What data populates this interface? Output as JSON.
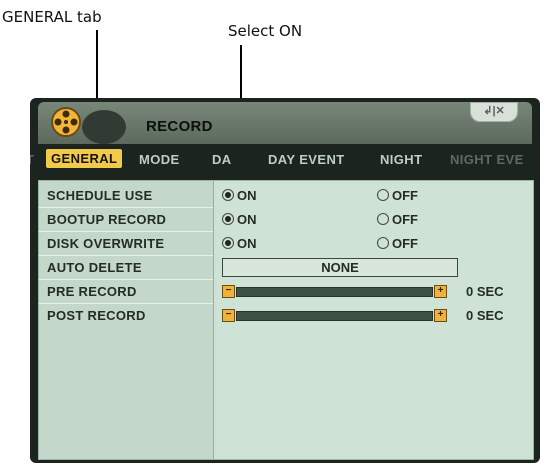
{
  "callouts": {
    "general_tab": "GENERAL tab",
    "select_on": "Select ON"
  },
  "window": {
    "title": "RECORD",
    "controls": "↲|✕"
  },
  "tabs": [
    {
      "label": "GENERAL",
      "active": true
    },
    {
      "label": "MODE",
      "active": false
    },
    {
      "label": "DA",
      "active": false
    },
    {
      "label": "DAY EVENT",
      "active": false
    },
    {
      "label": "NIGHT",
      "active": false
    },
    {
      "label": "NIGHT EVE",
      "active": false
    }
  ],
  "settings": {
    "schedule_use": {
      "label": "SCHEDULE USE",
      "on": "ON",
      "off": "OFF",
      "selected": "ON"
    },
    "bootup_record": {
      "label": "BOOTUP RECORD",
      "on": "ON",
      "off": "OFF",
      "selected": "ON"
    },
    "disk_overwrite": {
      "label": "DISK OVERWRITE",
      "on": "ON",
      "off": "OFF",
      "selected": "ON"
    },
    "auto_delete": {
      "label": "AUTO DELETE",
      "value": "NONE"
    },
    "pre_record": {
      "label": "PRE RECORD",
      "value": "0 SEC",
      "minus": "−",
      "plus": "+"
    },
    "post_record": {
      "label": "POST RECORD",
      "value": "0 SEC",
      "minus": "−",
      "plus": "+"
    }
  },
  "colors": {
    "active_tab": "#f2c94a",
    "panel": "#cfe2d6",
    "slider_button": "#f0b23c"
  }
}
